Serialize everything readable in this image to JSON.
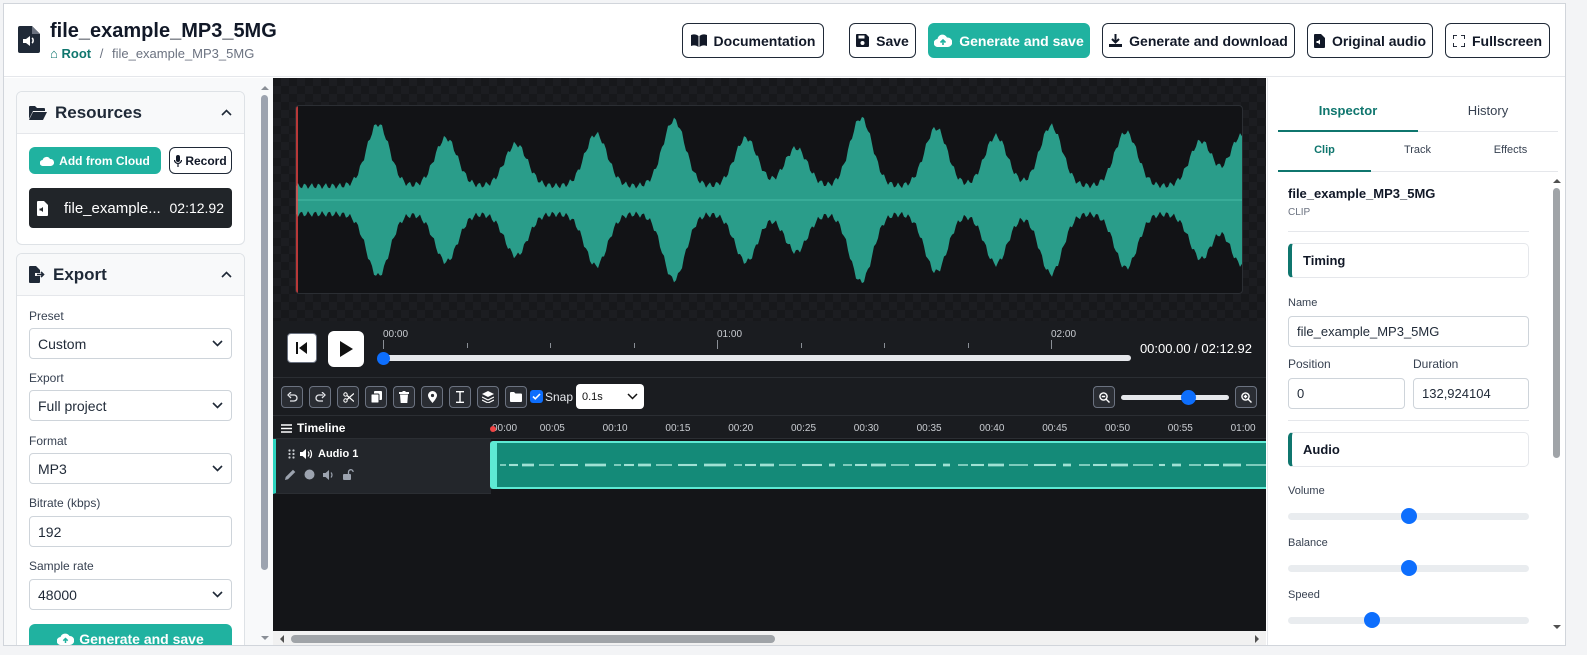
{
  "header": {
    "title": "file_example_MP3_5MG",
    "breadcrumb_root": "Root",
    "breadcrumb_sep": "/",
    "breadcrumb_current": "file_example_MP3_5MG",
    "buttons": {
      "documentation": "Documentation",
      "save": "Save",
      "generate_and_save": "Generate and save",
      "generate_and_download": "Generate and download",
      "original_audio": "Original audio",
      "fullscreen": "Fullscreen"
    }
  },
  "resources": {
    "title": "Resources",
    "add_from_cloud": "Add from Cloud",
    "record": "Record",
    "items": [
      {
        "name": "file_example...",
        "duration": "02:12.92"
      }
    ]
  },
  "export": {
    "title": "Export",
    "preset_label": "Preset",
    "preset_value": "Custom",
    "export_label": "Export",
    "export_value": "Full project",
    "format_label": "Format",
    "format_value": "MP3",
    "bitrate_label": "Bitrate (kbps)",
    "bitrate_value": "192",
    "samplerate_label": "Sample rate",
    "samplerate_value": "48000",
    "generate_and_save": "Generate and save"
  },
  "player": {
    "ruler_ticks": [
      "00:00",
      "01:00",
      "02:00"
    ],
    "time_readout": "00:00.00 / 02:12.92",
    "progress": 0
  },
  "toolbar": {
    "snap_label": "Snap",
    "snap_checked": true,
    "snap_value": "0.1s",
    "zoom_level": 0.62
  },
  "timeline": {
    "title": "Timeline",
    "ticks": [
      "00:00",
      "00:05",
      "00:10",
      "00:15",
      "00:20",
      "00:25",
      "00:30",
      "00:35",
      "00:40",
      "00:45",
      "00:50",
      "00:55",
      "01:00"
    ],
    "track_name": "Audio 1"
  },
  "inspector": {
    "tabs": [
      "Inspector",
      "History"
    ],
    "subtabs": [
      "Clip",
      "Track",
      "Effects"
    ],
    "clip_name": "file_example_MP3_5MG",
    "clip_kind": "CLIP",
    "timing_title": "Timing",
    "name_label": "Name",
    "name_value": "file_example_MP3_5MG",
    "position_label": "Position",
    "position_value": "0",
    "duration_label": "Duration",
    "duration_value": "132,924104",
    "audio_title": "Audio",
    "volume_label": "Volume",
    "volume_value": 0.5,
    "balance_label": "Balance",
    "balance_value": 0.5,
    "speed_label": "Speed",
    "speed_value": 0.35
  },
  "colors": {
    "accent": "#20b2a0",
    "accent_dark": "#0f766e",
    "wave": "#2a9d8a",
    "clip": "#148a78",
    "slider_knob": "#0d6efd"
  }
}
